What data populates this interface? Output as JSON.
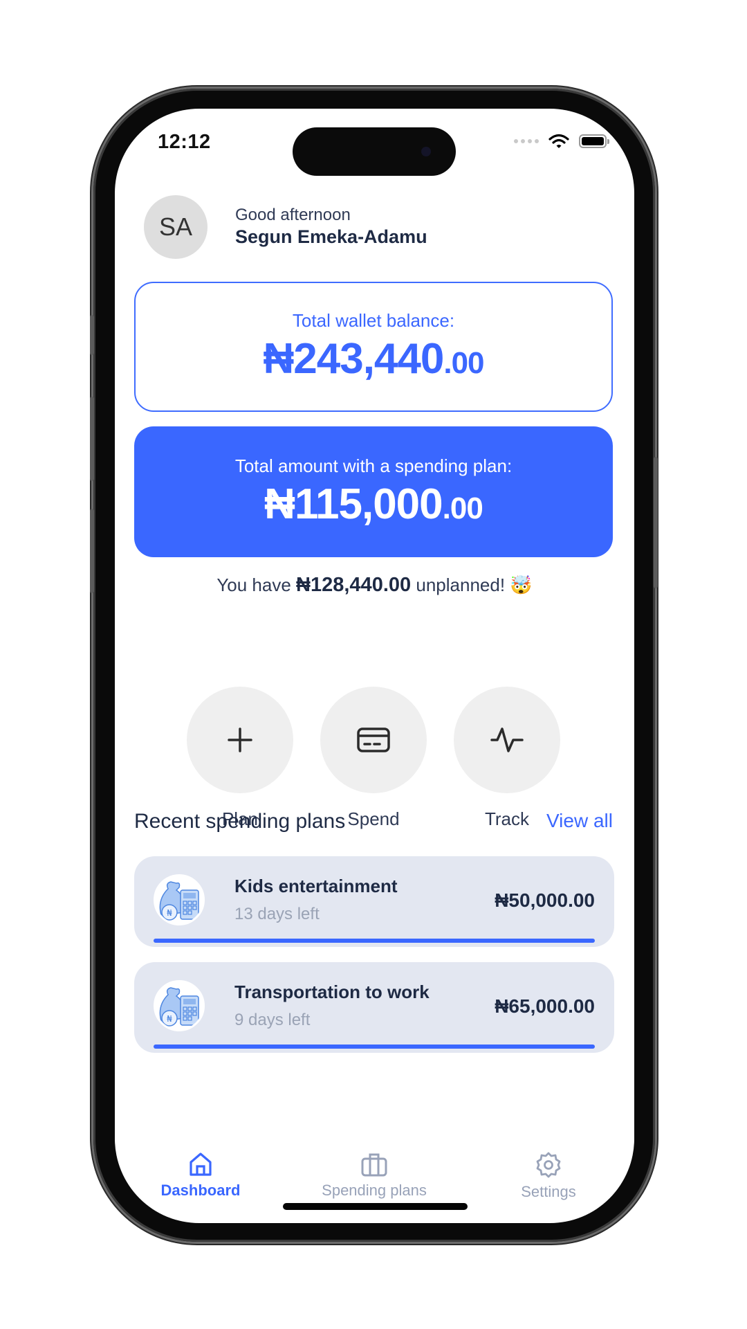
{
  "status_bar": {
    "time": "12:12"
  },
  "header": {
    "avatar_initials": "SA",
    "greeting": "Good afternoon",
    "user_name": "Segun Emeka-Adamu"
  },
  "wallet": {
    "label": "Total wallet balance:",
    "amount_main": "₦243,440",
    "amount_decimal": ".00"
  },
  "planned": {
    "label": "Total amount with a spending plan:",
    "amount_main": "₦115,000",
    "amount_decimal": ".00"
  },
  "unplanned": {
    "prefix": "You have",
    "amount": "₦128,440.00",
    "suffix": "unplanned!",
    "emoji": "🤯"
  },
  "actions": [
    {
      "label": "Plan",
      "icon": "plus-icon"
    },
    {
      "label": "Spend",
      "icon": "card-icon"
    },
    {
      "label": "Track",
      "icon": "activity-icon"
    }
  ],
  "recent": {
    "title": "Recent spending plans",
    "view_all": "View all",
    "items": [
      {
        "title": "Kids entertainment",
        "days_left": "13 days left",
        "amount": "₦50,000.00",
        "progress": 1.0
      },
      {
        "title": "Transportation to work",
        "days_left": "9 days left",
        "amount": "₦65,000.00",
        "progress": 1.0
      }
    ]
  },
  "tabbar": {
    "active": "dashboard",
    "items": [
      {
        "id": "dashboard",
        "label": "Dashboard",
        "icon": "home-icon"
      },
      {
        "id": "plans",
        "label": "Spending plans",
        "icon": "briefcase-icon"
      },
      {
        "id": "settings",
        "label": "Settings",
        "icon": "gear-icon"
      }
    ]
  },
  "colors": {
    "accent": "#3a67ff",
    "text_dark": "#1e2a44",
    "text_muted": "#9aa3b5",
    "card_bg": "#e3e7f1",
    "tab_inactive": "#98a2b8"
  }
}
